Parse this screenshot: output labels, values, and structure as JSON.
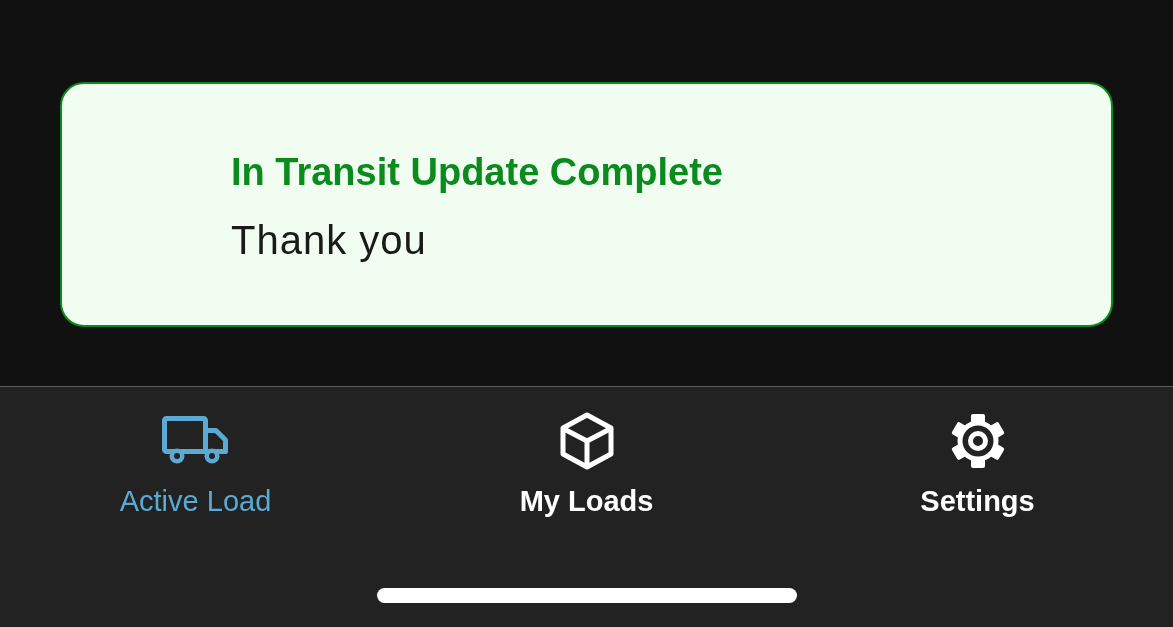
{
  "notification": {
    "title": "In Transit Update Complete",
    "message": "Thank you"
  },
  "tab_bar": {
    "tabs": [
      {
        "label": "Active Load",
        "selected": true
      },
      {
        "label": "My Loads",
        "selected": false
      },
      {
        "label": "Settings",
        "selected": false
      }
    ]
  }
}
